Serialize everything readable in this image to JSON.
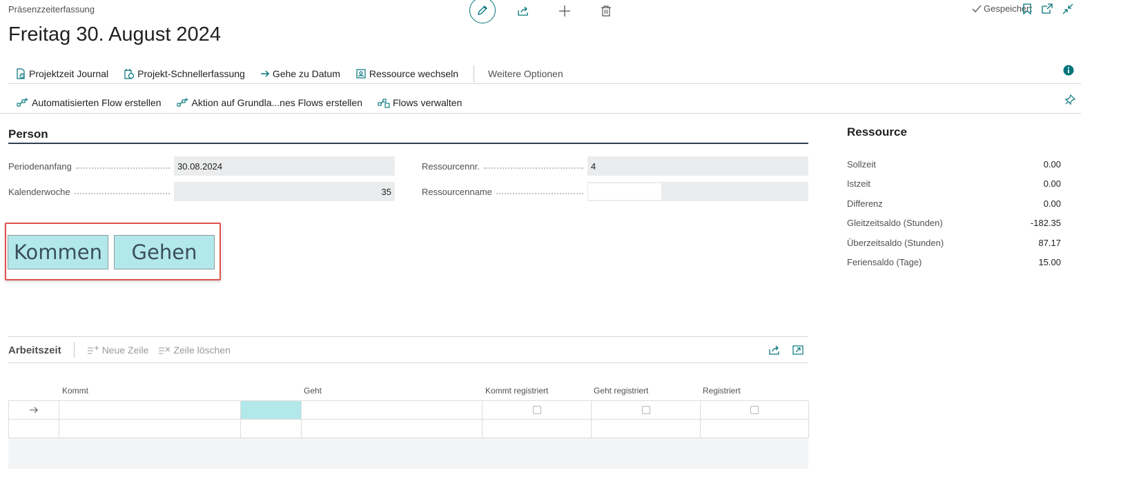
{
  "header": {
    "doc_type": "Präsenzzeiterfassung",
    "title": "Freitag 30. August 2024",
    "saved_label": "Gespeichert"
  },
  "actions": {
    "projektzeit_journal": "Projektzeit Journal",
    "projekt_schnellerfassung": "Projekt-Schnellerfassung",
    "gehe_zu_datum": "Gehe zu Datum",
    "ressource_wechseln": "Ressource wechseln",
    "weitere_optionen": "Weitere Optionen"
  },
  "flows": {
    "automatisierten_flow": "Automatisierten Flow erstellen",
    "aktion_flow": "Aktion auf Grundla...nes Flows erstellen",
    "flows_verwalten": "Flows verwalten"
  },
  "person": {
    "title": "Person",
    "periodenanfang_label": "Periodenanfang",
    "periodenanfang_value": "30.08.2024",
    "kalenderwoche_label": "Kalenderwoche",
    "kalenderwoche_value": "35",
    "ressourcennr_label": "Ressourcennr.",
    "ressourcennr_value": "4",
    "ressourcenname_label": "Ressourcenname",
    "ressourcenname_value": ""
  },
  "buttons": {
    "kommen": "Kommen",
    "gehen": "Gehen"
  },
  "ressource": {
    "title": "Ressource",
    "rows": [
      {
        "label": "Sollzeit",
        "value": "0.00"
      },
      {
        "label": "Istzeit",
        "value": "0.00"
      },
      {
        "label": "Differenz",
        "value": "0.00"
      },
      {
        "label": "Gleitzeitsaldo (Stunden)",
        "value": "-182.35"
      },
      {
        "label": "Überzeitsaldo (Stunden)",
        "value": "87.17"
      },
      {
        "label": "Feriensaldo (Tage)",
        "value": "15.00"
      }
    ]
  },
  "arbeitszeit": {
    "title": "Arbeitszeit",
    "neue_zeile": "Neue Zeile",
    "zeile_loeschen": "Zeile löschen",
    "columns": {
      "kommt": "Kommt",
      "geht": "Geht",
      "kommt_registriert": "Kommt registriert",
      "geht_registriert": "Geht registriert",
      "registriert": "Registriert"
    }
  },
  "colors": {
    "accent": "#00747a",
    "button_bg": "#b3e8ea",
    "highlight": "#e0504a"
  }
}
